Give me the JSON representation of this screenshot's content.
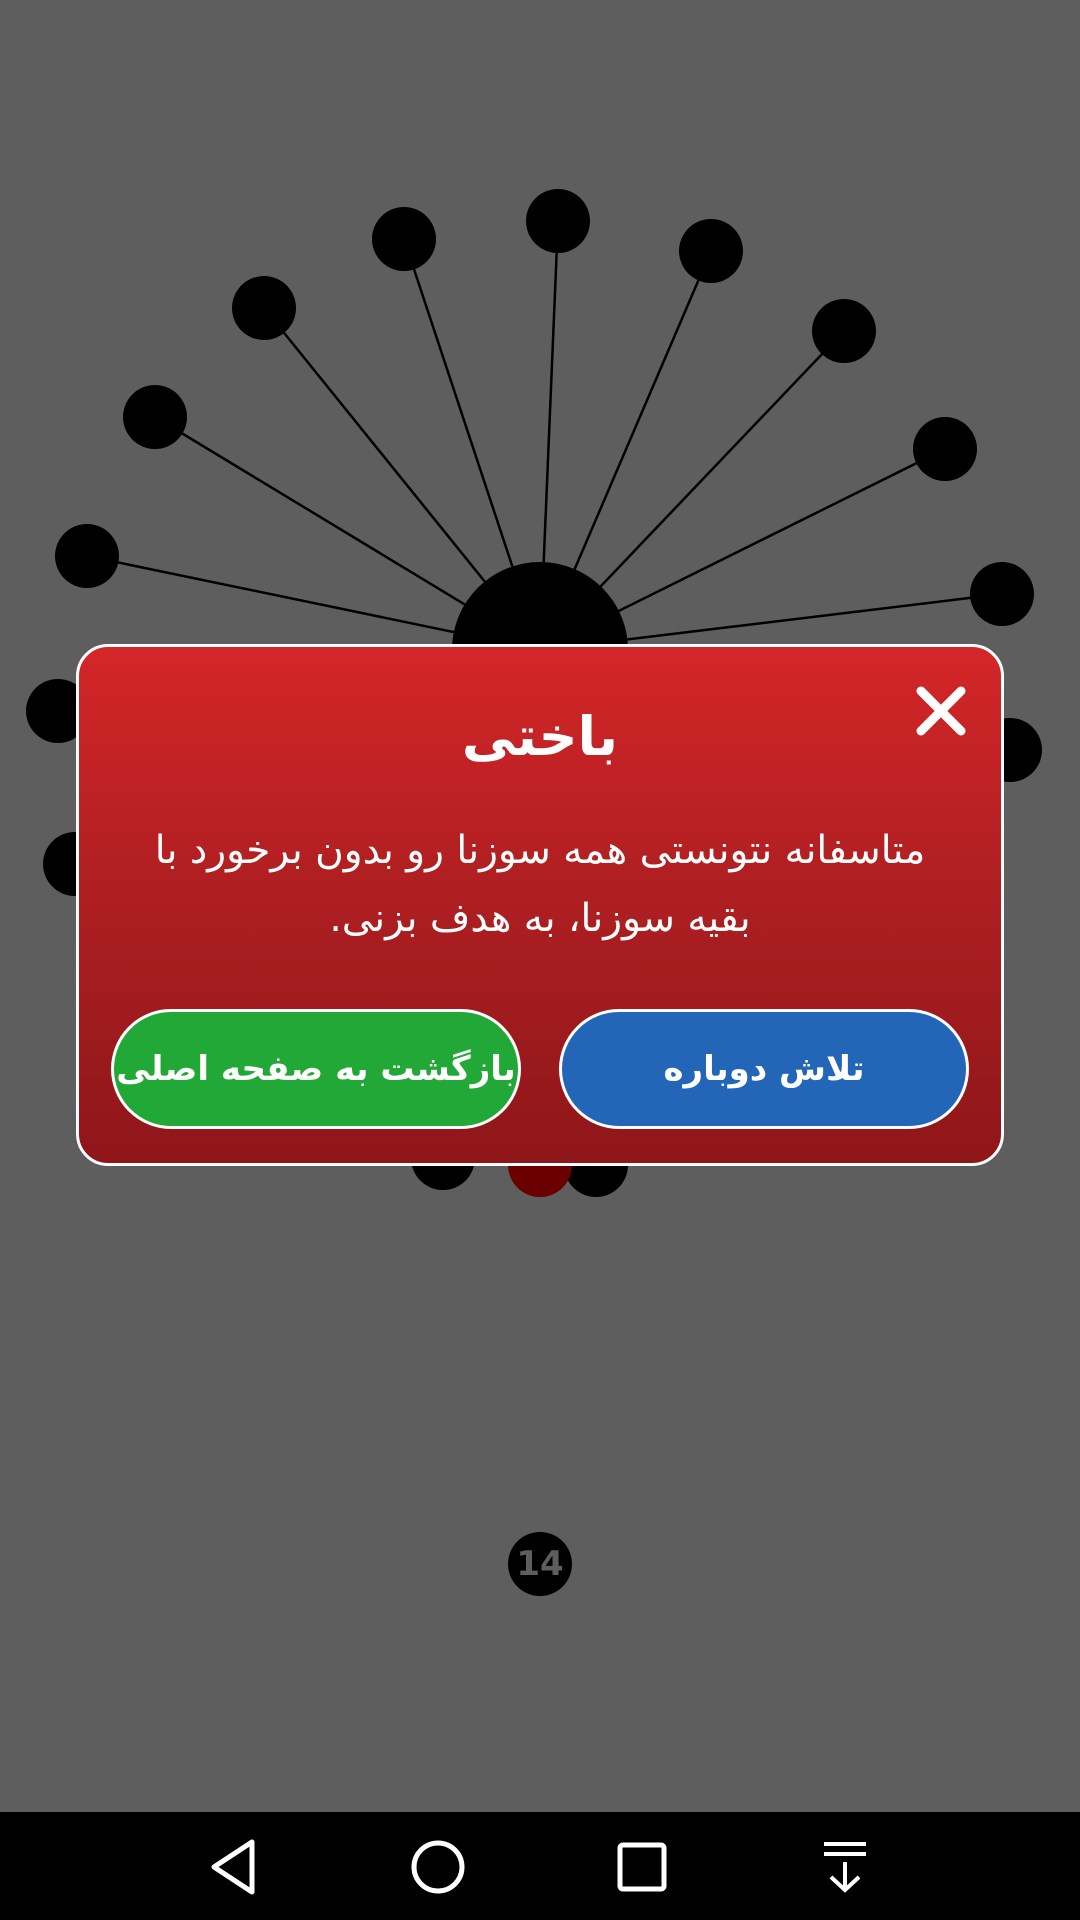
{
  "game": {
    "pins_count": 15,
    "state": "lost"
  },
  "modal": {
    "title": "باختی",
    "message": "متاسفانه نتونستی همه سوزنا رو بدون برخورد با بقیه سوزنا، به هدف بزنی.",
    "close_icon": "close-icon",
    "retry_label": "تلاش دوباره",
    "home_label": "بازگشت به صفحه اصلی"
  },
  "hud": {
    "remaining_pins": "14"
  },
  "navbar": {
    "icons": [
      "back-icon",
      "home-icon",
      "recents-icon",
      "notification-pull-icon"
    ]
  },
  "colors": {
    "background": "#5e5e5e",
    "modal_red": "#c62226",
    "retry_blue": "#2366b8",
    "home_green": "#22a836"
  }
}
